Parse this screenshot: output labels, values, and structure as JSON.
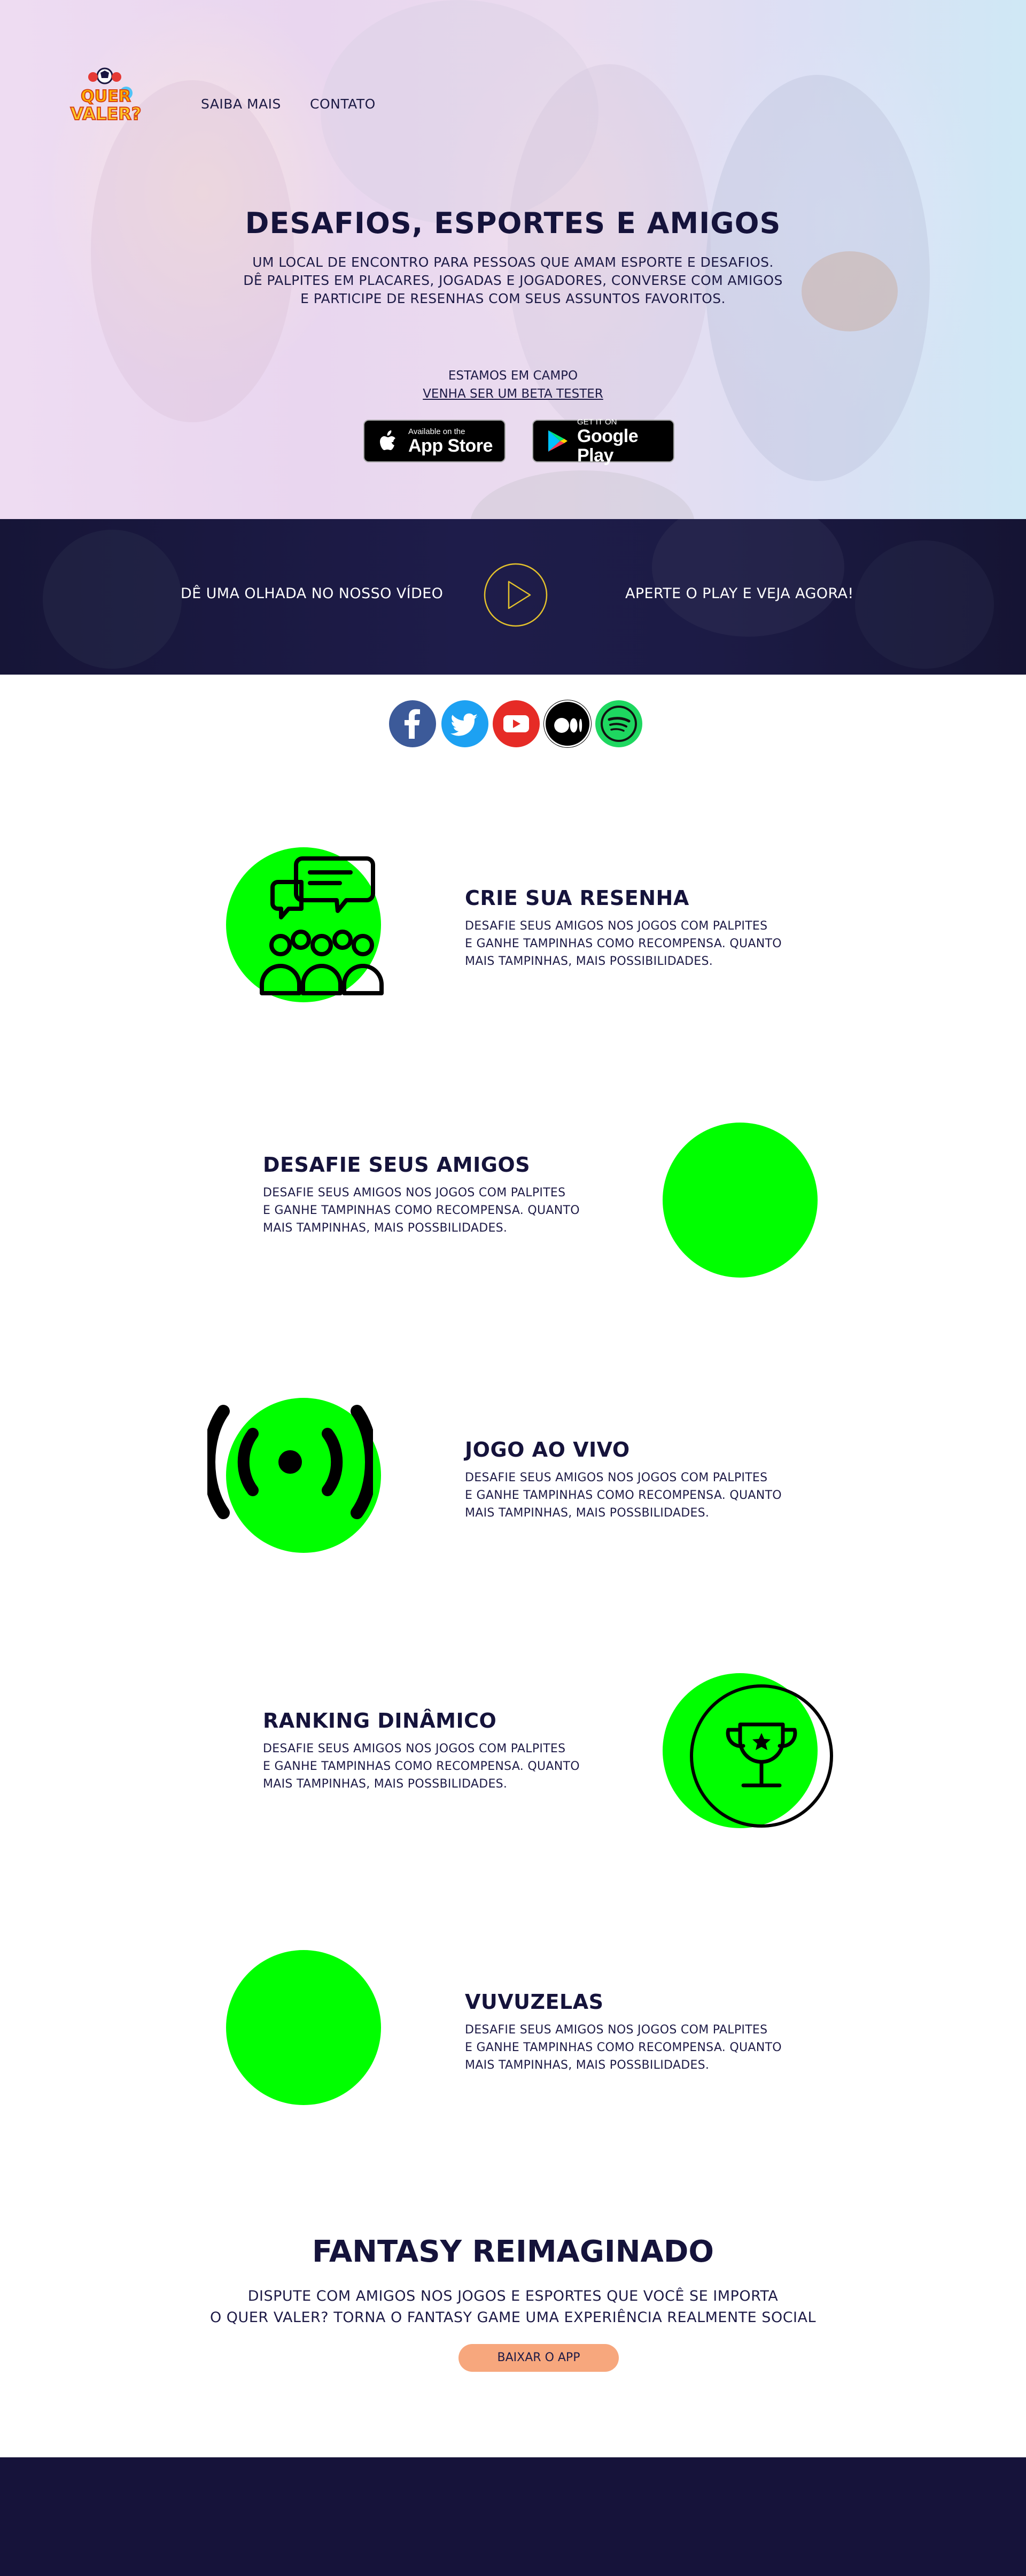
{
  "header": {
    "logo_text_top": "QUER",
    "logo_text_bottom": "VALER?",
    "nav": [
      {
        "label": "SAIBA MAIS"
      },
      {
        "label": "CONTATO"
      }
    ]
  },
  "hero": {
    "title": "DESAFIOS, ESPORTES E AMIGOS",
    "subtitle_lines": [
      "UM LOCAL DE ENCONTRO PARA PESSOAS QUE AMAM ESPORTE E DESAFIOS.",
      "DÊ PALPITES EM PLACARES, JOGADAS E JOGADORES, CONVERSE COM AMIGOS",
      "E PARTICIPE DE RESENHAS COM SEUS ASSUNTOS FAVORITOS."
    ],
    "beta_line1": "ESTAMOS EM CAMPO",
    "beta_line2": "VENHA SER UM BETA TESTER",
    "app_store": {
      "small": "Available on the",
      "big": "App Store"
    },
    "google_play": {
      "small": "GET IT ON",
      "big": "Google Play"
    }
  },
  "video": {
    "left_text": "DÊ UMA OLHADA NO NOSSO VÍDEO",
    "right_text": "APERTE O PLAY E VEJA AGORA!"
  },
  "social": [
    {
      "name": "facebook-icon"
    },
    {
      "name": "twitter-icon"
    },
    {
      "name": "youtube-icon"
    },
    {
      "name": "medium-icon"
    },
    {
      "name": "spotify-icon"
    }
  ],
  "features": [
    {
      "title": "CRIE SUA RESENHA",
      "lines": [
        "DESAFIE SEUS AMIGOS NOS JOGOS COM PALPITES",
        "E GANHE TAMPINHAS COMO RECOMPENSA. QUANTO",
        "MAIS TAMPINHAS, MAIS POSSIBILIDADES."
      ]
    },
    {
      "title": "DESAFIE SEUS AMIGOS",
      "lines": [
        "DESAFIE SEUS AMIGOS NOS JOGOS COM PALPITES",
        "E GANHE TAMPINHAS COMO RECOMPENSA. QUANTO",
        "MAIS TAMPINHAS, MAIS POSSBILIDADES."
      ]
    },
    {
      "title": "JOGO AO VIVO",
      "lines": [
        "DESAFIE SEUS AMIGOS NOS JOGOS COM PALPITES",
        "E GANHE TAMPINHAS COMO RECOMPENSA. QUANTO",
        "MAIS TAMPINHAS, MAIS POSSBILIDADES."
      ]
    },
    {
      "title": "RANKING DINÂMICO",
      "lines": [
        "DESAFIE SEUS AMIGOS NOS JOGOS COM PALPITES",
        "E GANHE TAMPINHAS COMO RECOMPENSA. QUANTO",
        "MAIS TAMPINHAS, MAIS POSSBILIDADES."
      ]
    },
    {
      "title": "VUVUZELAS",
      "lines": [
        "DESAFIE SEUS AMIGOS NOS JOGOS COM PALPITES",
        "E GANHE TAMPINHAS COMO RECOMPENSA. QUANTO",
        "MAIS TAMPINHAS, MAIS POSSBILIDADES."
      ]
    }
  ],
  "fantasy": {
    "title": "FANTASY REIMAGINADO",
    "lines": [
      "DISPUTE COM AMIGOS NOS JOGOS E ESPORTES QUE VOCÊ SE IMPORTA",
      "O QUER VALER? TORNA O FANTASY GAME UMA EXPERIÊNCIA REALMENTE SOCIAL"
    ],
    "cta_label": "BAIXAR O APP"
  },
  "colors": {
    "accent_green": "#00ff00",
    "navy": "#16133a",
    "cta": "#f7a77d",
    "play_ring": "#e3c12c"
  }
}
